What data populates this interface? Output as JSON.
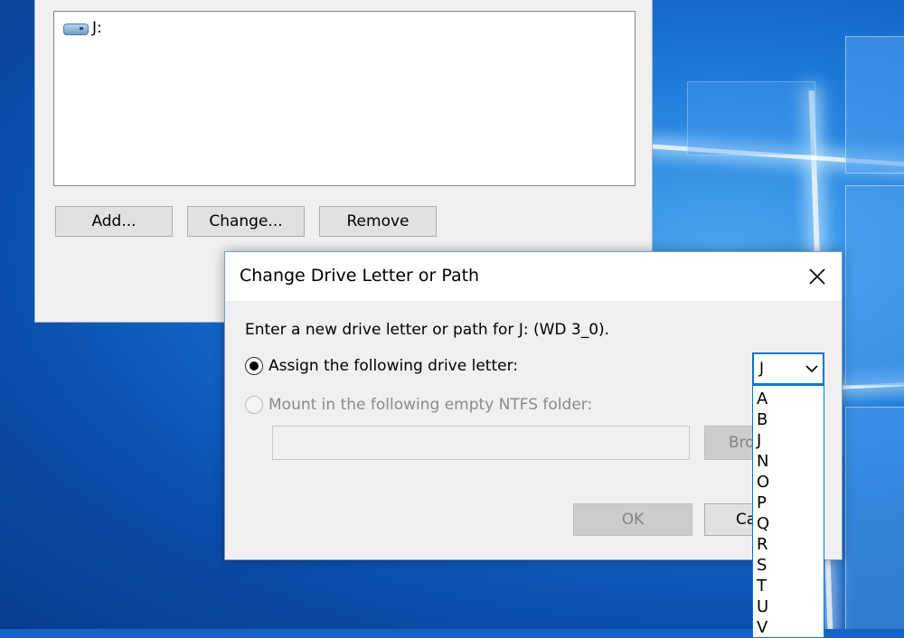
{
  "parent": {
    "drive_item": "J:",
    "buttons": {
      "add": "Add...",
      "change": "Change...",
      "remove": "Remove"
    }
  },
  "dialog": {
    "title": "Change Drive Letter or Path",
    "prompt": "Enter a new drive letter or path for J: (WD 3_0).",
    "assign_option": "Assign the following drive letter:",
    "mount_option": "Mount in the following empty NTFS folder:",
    "folder_value": "",
    "browse_label": "Bro",
    "ok_label": "OK",
    "cancel_label": "Ca",
    "selected_letter": "J",
    "letter_options": [
      "A",
      "B",
      "J",
      "N",
      "O",
      "P",
      "Q",
      "R",
      "S",
      "T",
      "U",
      "V"
    ]
  },
  "colors": {
    "accent": "#0078d7",
    "disabled_text": "#838383"
  },
  "icons": {
    "drive": "drive-icon",
    "close": "close-icon",
    "chevron": "chevron-down-icon"
  }
}
